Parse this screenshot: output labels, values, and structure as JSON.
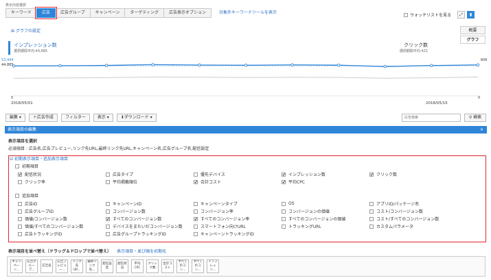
{
  "header": {
    "display_label": "表示内容選択",
    "tabs": [
      "キーワード",
      "広告",
      "広告グループ",
      "キャンペーン",
      "ターゲティング",
      "広告表示オプション"
    ],
    "active_tab": "広告",
    "tool_link": "対象外キーワードツールを表示",
    "watchlist_label": "ウォッチリストを見る"
  },
  "graph": {
    "settings_label": "グラフの設定",
    "left_metric": {
      "name": "インプレッション数",
      "avg": "選択期間平均:44,885"
    },
    "right_metric": {
      "name": "クリック数",
      "avg": "選択期間平均:421"
    },
    "side_tabs": [
      "概要",
      "グラフ"
    ]
  },
  "chart_data": {
    "type": "line",
    "x_start_label": "2018/05/01",
    "x_end_label": "2018/05/15",
    "left_axis": {
      "max_label": "53,444",
      "avg_label": "44,885",
      "min_label": "0"
    },
    "right_axis": {
      "max_label": "606",
      "min_label": "0"
    },
    "series": [
      {
        "values": [
          44885,
          45200,
          45600,
          46800,
          46200,
          45900,
          46400,
          46000,
          44000,
          45500,
          46400
        ]
      },
      {
        "values": [
          300,
          305,
          310,
          320,
          318,
          312,
          316,
          314,
          300,
          308,
          320
        ]
      }
    ],
    "left_ylim": [
      0,
      53444
    ],
    "right_ylim": [
      0,
      606
    ],
    "colors": {
      "primary": "#2f85d8",
      "secondary": "#cccccc"
    }
  },
  "toolbar": {
    "edit": "編集 ▾",
    "create_ad": "＋広告作成",
    "filter": "フィルター",
    "display": "表示 ▾",
    "download": "⬇ダウンロード ▾",
    "search_placeholder": "広告検索",
    "search_button": "検索"
  },
  "panel": {
    "title": "表示項目の編集",
    "close": "×",
    "select_title": "表示項目を選択",
    "required_text": "必須項目 : 広告名,広告プレビュー,リンク先URL,最終リンク先URL,キャンペーン名,広告グループ名,配信設定",
    "toggle_label": "初期表示項目・追加表示項目",
    "initial_label": "初期項目",
    "initial_items": [
      {
        "label": "配信状況",
        "on": true
      },
      {
        "label": "広告タイプ",
        "on": false
      },
      {
        "label": "優先デバイス",
        "on": false
      },
      {
        "label": "インプレッション数",
        "on": true
      },
      {
        "label": "クリック数",
        "on": true
      },
      {
        "label": "クリック率",
        "on": false
      },
      {
        "label": "平均掲載順位",
        "on": false
      },
      {
        "label": "合計コスト",
        "on": true
      },
      {
        "label": "平均CPC",
        "on": true
      }
    ],
    "added_label": "追加項目",
    "added_items": [
      {
        "label": "広告ID",
        "on": false
      },
      {
        "label": "キャンペーンID",
        "on": false
      },
      {
        "label": "キャンペーンタイプ",
        "on": false
      },
      {
        "label": "OS",
        "on": false
      },
      {
        "label": "アプリID/パッケージ名",
        "on": false
      },
      {
        "label": "広告グループID",
        "on": false
      },
      {
        "label": "コンバージョン数",
        "on": false
      },
      {
        "label": "コンバージョン率",
        "on": false
      },
      {
        "label": "コンバージョンの価値",
        "on": false
      },
      {
        "label": "コスト/コンバージョン数",
        "on": false
      },
      {
        "label": "価値/コンバージョン数",
        "on": false
      },
      {
        "label": "すべてのコンバージョン数",
        "on": true
      },
      {
        "label": "すべてのコンバージョン率",
        "on": true
      },
      {
        "label": "すべてのコンバージョンの価値",
        "on": false
      },
      {
        "label": "コスト/すべてのコンバージョン数",
        "on": false
      },
      {
        "label": "価値/すべてのコンバージョン数",
        "on": false
      },
      {
        "label": "デバイスをまたいだコンバージョン数",
        "on": false
      },
      {
        "label": "スマートフォン向けURL",
        "on": false
      },
      {
        "label": "トラッキングURL",
        "on": false
      },
      {
        "label": "カスタムパラメータ",
        "on": false
      },
      {
        "label": "広告トラッキングID",
        "on": false
      },
      {
        "label": "広告グループトラッキングID",
        "on": false
      },
      {
        "label": "キャンペーントラッキングID",
        "on": false
      }
    ],
    "order_title": "表示項目を並べ替え（ドラッグ＆ドロップで並べ替え）",
    "order_link": "表示項目・並び順を初期化",
    "order_chips": [
      "キャンペーン...",
      "広告グループ...",
      "広告名",
      "広告プレビュー...",
      "リンク先UR...",
      "最終リンク先...",
      "配信設定",
      "配信状況",
      "平均CPC",
      "クリック数",
      "合計コスト",
      "すべてのコン...",
      "すべてのコン...",
      "インプレッシ..."
    ]
  }
}
